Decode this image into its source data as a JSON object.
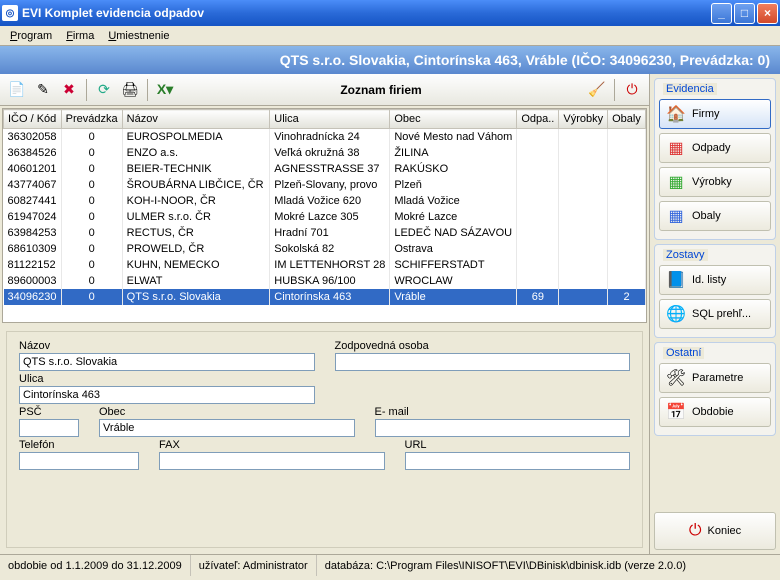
{
  "window": {
    "title": "EVI Komplet evidencia odpadov"
  },
  "menu": {
    "program": "Program",
    "firma": "Firma",
    "umiestnenie": "Umiestnenie"
  },
  "header": {
    "text": "QTS s.r.o. Slovakia, Cintorínska 463, Vráble (IČO: 34096230, Prevádzka: 0)"
  },
  "toolbar": {
    "title": "Zoznam firiem"
  },
  "grid": {
    "columns": {
      "ico": "IČO / Kód",
      "prev": "Prevádzka",
      "nazov": "Názov",
      "ulica": "Ulica",
      "obec": "Obec",
      "odpa": "Odpa..",
      "vyrobky": "Výrobky",
      "obaly": "Obaly"
    },
    "rows": [
      {
        "ico": "36302058",
        "prev": "0",
        "nazov": "EUROSPOLMEDIA",
        "ulica": "Vinohradnícka 24",
        "obec": "Nové Mesto nad Váhom",
        "odpa": "",
        "vyr": "",
        "oba": ""
      },
      {
        "ico": "36384526",
        "prev": "0",
        "nazov": "ENZO a.s.",
        "ulica": "Veľká okružná 38",
        "obec": "ŽILINA",
        "odpa": "",
        "vyr": "",
        "oba": ""
      },
      {
        "ico": "40601201",
        "prev": "0",
        "nazov": "BEIER-TECHNIK",
        "ulica": "AGNESSTRASSE 37",
        "obec": "RAKÚSKO",
        "odpa": "",
        "vyr": "",
        "oba": ""
      },
      {
        "ico": "43774067",
        "prev": "0",
        "nazov": "ŠROUBÁRNA LIBČICE, ČR",
        "ulica": "Plzeň-Slovany, provo",
        "obec": "Plzeň",
        "odpa": "",
        "vyr": "",
        "oba": ""
      },
      {
        "ico": "60827441",
        "prev": "0",
        "nazov": "KOH-I-NOOR, ČR",
        "ulica": "Mladá Vožice 620",
        "obec": "Mladá Vožice",
        "odpa": "",
        "vyr": "",
        "oba": ""
      },
      {
        "ico": "61947024",
        "prev": "0",
        "nazov": "ULMER s.r.o. ČR",
        "ulica": "Mokré Lazce 305",
        "obec": "Mokré Lazce",
        "odpa": "",
        "vyr": "",
        "oba": ""
      },
      {
        "ico": "63984253",
        "prev": "0",
        "nazov": "RECTUS, ČR",
        "ulica": "Hradní 701",
        "obec": "LEDEČ NAD SÁZAVOU",
        "odpa": "",
        "vyr": "",
        "oba": ""
      },
      {
        "ico": "68610309",
        "prev": "0",
        "nazov": "PROWELD, ČR",
        "ulica": "Sokolská 82",
        "obec": "Ostrava",
        "odpa": "",
        "vyr": "",
        "oba": ""
      },
      {
        "ico": "81122152",
        "prev": "0",
        "nazov": "KUHN, NEMECKO",
        "ulica": "IM LETTENHORST 28",
        "obec": "SCHIFFERSTADT",
        "odpa": "",
        "vyr": "",
        "oba": ""
      },
      {
        "ico": "89600003",
        "prev": "0",
        "nazov": "ELWAT",
        "ulica": "HUBSKA 96/100",
        "obec": "WROCLAW",
        "odpa": "",
        "vyr": "",
        "oba": ""
      },
      {
        "ico": "34096230",
        "prev": "0",
        "nazov": "QTS s.r.o. Slovakia",
        "ulica": "Cintorínska 463",
        "obec": "Vráble",
        "odpa": "69",
        "vyr": "",
        "oba": "2",
        "selected": true
      }
    ]
  },
  "detail": {
    "labels": {
      "nazov": "Názov",
      "zodp": "Zodpovedná osoba",
      "ulica": "Ulica",
      "psc": "PSČ",
      "obec": "Obec",
      "email": "E- mail",
      "telefon": "Telefón",
      "fax": "FAX",
      "url": "URL"
    },
    "values": {
      "nazov": "QTS s.r.o. Slovakia",
      "zodp": "",
      "ulica": "Cintorínska 463",
      "psc": "",
      "obec": "Vráble",
      "email": "",
      "telefon": "",
      "fax": "",
      "url": ""
    }
  },
  "nav": {
    "groups": {
      "evidencia": "Evidencia",
      "zostavy": "Zostavy",
      "ostatni": "Ostatní"
    },
    "items": {
      "firmy": "Firmy",
      "odpady": "Odpady",
      "vyrobky": "Výrobky",
      "obaly": "Obaly",
      "idlisty": "Id. listy",
      "sqlprehl": "SQL prehľ...",
      "parametre": "Parametre",
      "obdobie": "Obdobie",
      "koniec": "Koniec"
    }
  },
  "status": {
    "obdobie": "obdobie od 1.1.2009 do 31.12.2009",
    "uzivatel": "užívateľ: Administrator",
    "db": "databáza: C:\\Program Files\\INISOFT\\EVI\\DBinisk\\dbinisk.idb (verze 2.0.0)"
  }
}
